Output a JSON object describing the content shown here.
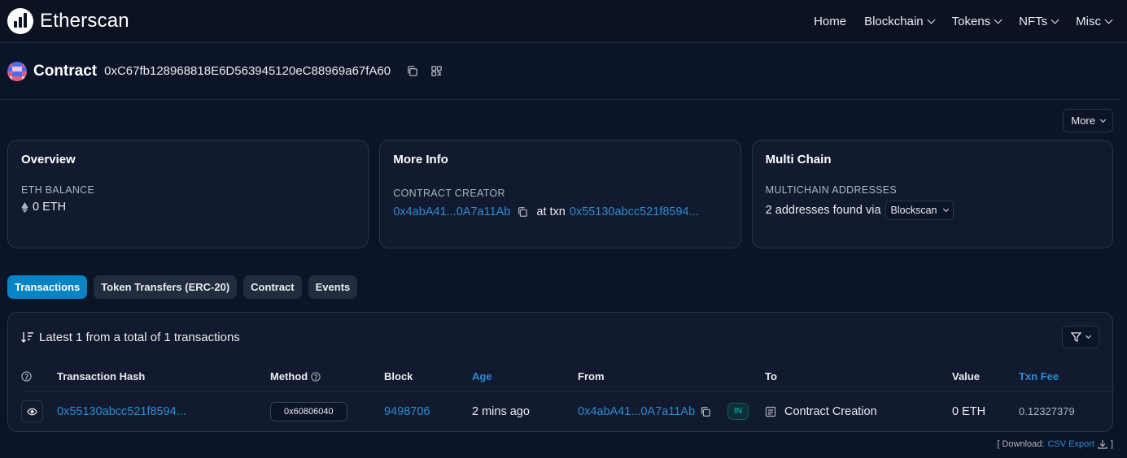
{
  "brand": {
    "name": "Etherscan"
  },
  "nav": [
    {
      "label": "Home",
      "dropdown": false
    },
    {
      "label": "Blockchain",
      "dropdown": true
    },
    {
      "label": "Tokens",
      "dropdown": true
    },
    {
      "label": "NFTs",
      "dropdown": true
    },
    {
      "label": "Misc",
      "dropdown": true
    }
  ],
  "page": {
    "title": "Contract",
    "address": "0xC67fb128968818E6D563945120eC88969a67fA60",
    "more_label": "More"
  },
  "overview": {
    "title": "Overview",
    "balance_label": "ETH BALANCE",
    "balance_value": "0 ETH"
  },
  "more_info": {
    "title": "More Info",
    "creator_label": "CONTRACT CREATOR",
    "creator_address": "0x4abA41...0A7a11Ab",
    "at_txn": "at txn",
    "creator_txn": "0x55130abcc521f8594..."
  },
  "multi_chain": {
    "title": "Multi Chain",
    "label": "MULTICHAIN ADDRESSES",
    "found_text": "2 addresses found via",
    "dropdown_label": "Blockscan"
  },
  "tabs": [
    {
      "label": "Transactions",
      "active": true
    },
    {
      "label": "Token Transfers (ERC-20)",
      "active": false
    },
    {
      "label": "Contract",
      "active": false
    },
    {
      "label": "Events",
      "active": false
    }
  ],
  "transactions": {
    "summary": "Latest 1 from a total of 1 transactions",
    "columns": {
      "hash": "Transaction Hash",
      "method": "Method",
      "block": "Block",
      "age": "Age",
      "from": "From",
      "to": "To",
      "value": "Value",
      "fee": "Txn Fee"
    },
    "rows": [
      {
        "hash": "0x55130abcc521f8594...",
        "method": "0x60806040",
        "block": "9498706",
        "age": "2 mins ago",
        "from": "0x4abA41...0A7a11Ab",
        "direction": "IN",
        "to": "Contract Creation",
        "value": "0 ETH",
        "fee": "0.12327379"
      }
    ]
  },
  "download": {
    "prefix": "[ Download:",
    "link": "CSV Export",
    "suffix": "]"
  },
  "colors": {
    "background": "#0c1427",
    "card": "#111a2e",
    "accent": "#0784c3",
    "link": "#2e8bd3",
    "success": "#00a186"
  },
  "icons": [
    "etherscan-logo",
    "copy-icon",
    "qr-code-icon",
    "ethereum-icon",
    "sort-icon",
    "filter-icon",
    "help-icon",
    "eye-icon",
    "document-icon",
    "download-icon",
    "chevron-down-icon"
  ]
}
